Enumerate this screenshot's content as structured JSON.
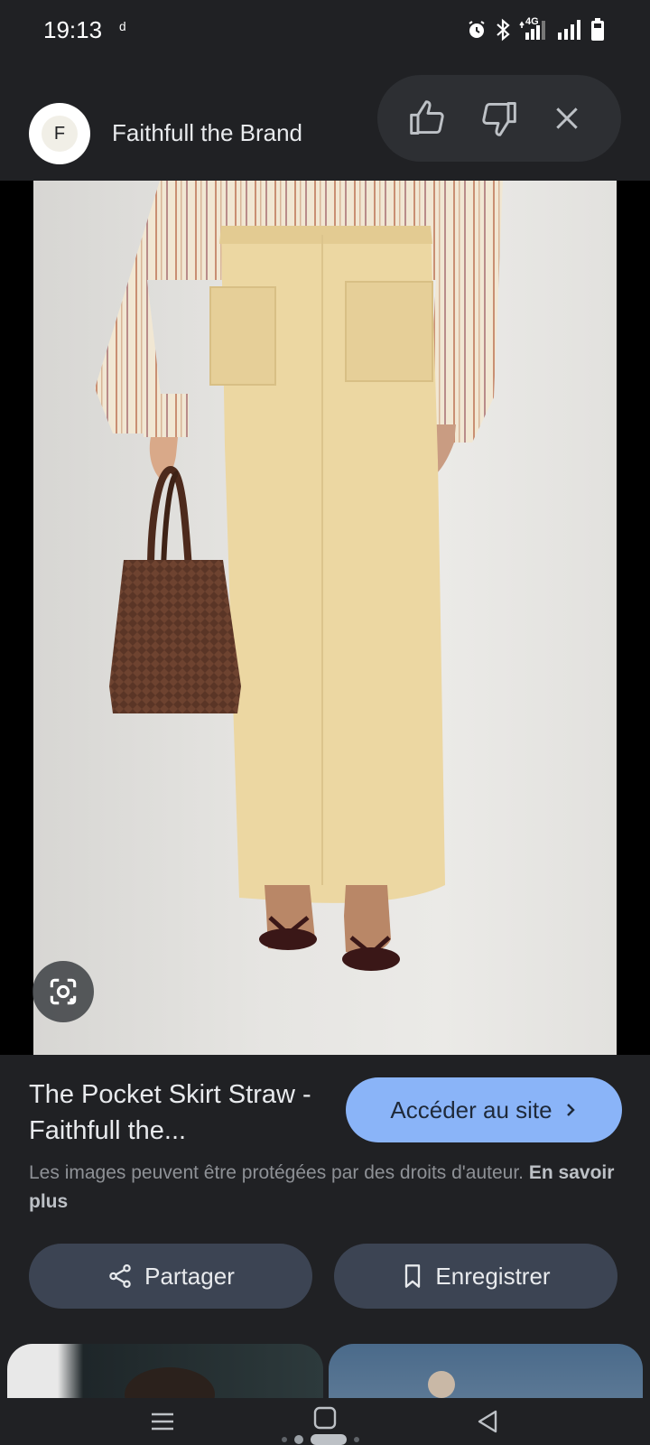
{
  "status_bar": {
    "time": "19:13",
    "notification_glyph": "ᵈ",
    "icons": [
      "alarm-icon",
      "bluetooth-icon",
      "4g-signal-icon",
      "signal-icon",
      "battery-icon"
    ],
    "network_label": "4G"
  },
  "header": {
    "avatar_letter": "F",
    "brand": "Faithfull the Brand",
    "actions": [
      "thumbs-up-icon",
      "thumbs-down-icon",
      "close-icon"
    ]
  },
  "image": {
    "lens_icon": "google-lens-icon"
  },
  "info": {
    "title": "The Pocket Skirt Straw - Faithfull the...",
    "visit_button": "Accéder au site",
    "copyright_text": "Les images peuvent être protégées par des droits d'auteur.",
    "learn_more": "En savoir plus"
  },
  "actions": {
    "share": "Partager",
    "save": "Enregistrer"
  },
  "nav": {
    "buttons": [
      "recent-apps-icon",
      "home-icon",
      "back-icon"
    ]
  },
  "colors": {
    "background": "#202124",
    "accent": "#8ab4f8",
    "button": "#3c4453",
    "skirt": "#ecd7a2"
  }
}
